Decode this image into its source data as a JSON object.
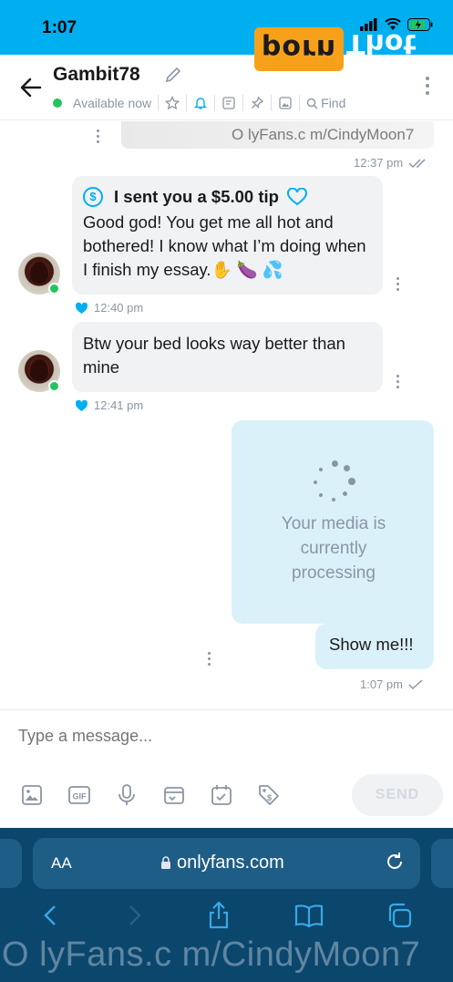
{
  "status_bar": {
    "time": "1:07"
  },
  "watermark": {
    "badge": "porn",
    "text": "Thot",
    "overlay_text": "O lyFans.c m/CindyMoon7"
  },
  "header": {
    "username": "Gambit78",
    "availability": "Available now",
    "find_label": "Find"
  },
  "messages": [
    {
      "id": "prev",
      "time": "12:37 pm",
      "direction": "out",
      "preview_watermark": "O lyFans.c m/CindyMoon7"
    },
    {
      "id": "tip",
      "direction": "in",
      "tip_label": "I sent you a $5.00 tip",
      "text": "Good god! You get me all hot and bothered! I know what I’m doing when I finish my essay.✋ 🍆 💦",
      "time": "12:40 pm"
    },
    {
      "id": "bed",
      "direction": "in",
      "text": "Btw your bed looks way better than mine",
      "time": "12:41 pm"
    },
    {
      "id": "media",
      "direction": "out",
      "processing_text": "Your media is currently processing",
      "caption": "Show me!!!",
      "time": "1:07 pm"
    }
  ],
  "composer": {
    "placeholder": "Type a message...",
    "send_label": "SEND"
  },
  "browser": {
    "aa_label": "AA",
    "url": "onlyfans.com"
  },
  "colors": {
    "brand": "#00aff0",
    "online": "#22c55e",
    "bubble_in": "#f0f2f4",
    "bubble_out": "#daf1fa",
    "safari_bg": "#0b466d"
  }
}
